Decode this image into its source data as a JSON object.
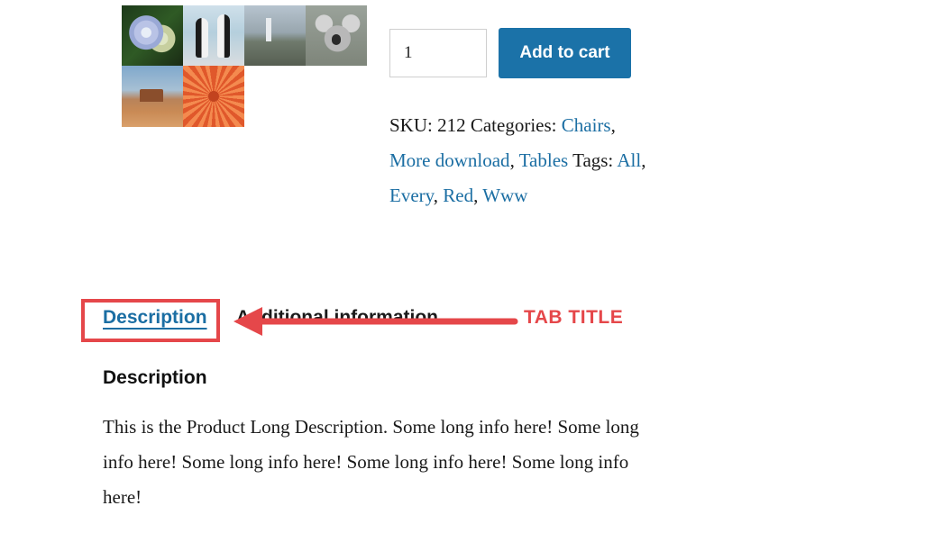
{
  "gallery": {
    "thumbnails": [
      "hydrangea-thumbnail",
      "penguins-thumbnail",
      "lighthouse-thumbnail",
      "koala-thumbnail",
      "desert-thumbnail",
      "chrysanthemum-thumbnail"
    ]
  },
  "cart": {
    "quantity_value": "1",
    "add_to_cart_label": "Add to cart",
    "button_color": "#1b72a8"
  },
  "meta": {
    "sku_label": "SKU:",
    "sku_value": "212",
    "categories_label": "Categories:",
    "categories": [
      "Chairs",
      "More download",
      "Tables"
    ],
    "tags_label": "Tags:",
    "tags": [
      "All",
      "Every",
      "Red",
      "Www"
    ],
    "link_color": "#1b6ea3"
  },
  "tabs": {
    "items": [
      {
        "label": "Description",
        "active": true
      },
      {
        "label": "Additional information",
        "active": false
      }
    ]
  },
  "annotation": {
    "label": "TAB TITLE",
    "color": "#e5474a"
  },
  "panel": {
    "heading": "Description",
    "body": "This is the Product Long Description. Some long info here! Some long info here! Some long info here! Some long info here! Some long info here!"
  }
}
